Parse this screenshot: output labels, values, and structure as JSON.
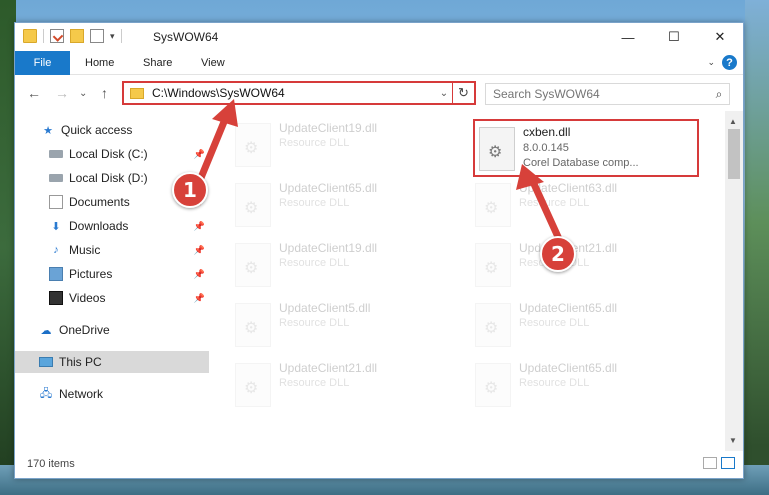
{
  "window": {
    "title": "SysWOW64",
    "controls": {
      "minimize": "—",
      "maximize": "☐",
      "close": "✕"
    }
  },
  "qat": {
    "dropdown": "▾"
  },
  "ribbon": {
    "file_label": "File",
    "tabs": [
      "Home",
      "Share",
      "View"
    ],
    "help": "?",
    "expand": "⌄"
  },
  "nav": {
    "back": "←",
    "forward": "→",
    "recent": "⌄",
    "up": "↑",
    "address": "C:\\Windows\\SysWOW64",
    "address_dropdown": "⌄",
    "refresh": "↻",
    "search_placeholder": "Search SysWOW64",
    "search_icon": "⌕"
  },
  "sidebar": {
    "pin": "📌",
    "items": [
      {
        "label": "Quick access",
        "icon": "star-icon",
        "glyph": "★"
      },
      {
        "label": "Local Disk (C:)",
        "icon": "disk-icon",
        "glyph": ""
      },
      {
        "label": "Local Disk (D:)",
        "icon": "disk-icon",
        "glyph": ""
      },
      {
        "label": "Documents",
        "icon": "document-icon",
        "glyph": ""
      },
      {
        "label": "Downloads",
        "icon": "download-icon",
        "glyph": "⬇"
      },
      {
        "label": "Music",
        "icon": "music-icon",
        "glyph": "♪"
      },
      {
        "label": "Pictures",
        "icon": "pictures-icon",
        "glyph": ""
      },
      {
        "label": "Videos",
        "icon": "videos-icon",
        "glyph": ""
      },
      {
        "label": "OneDrive",
        "icon": "cloud-icon",
        "glyph": "☁"
      },
      {
        "label": "This PC",
        "icon": "pc-icon",
        "glyph": ""
      },
      {
        "label": "Network",
        "icon": "network-icon",
        "glyph": "🖧"
      }
    ]
  },
  "files": {
    "col1": [
      {
        "name": "UpdateClient19.dll",
        "sub": "Resource DLL"
      },
      {
        "name": "UpdateClient65.dll",
        "sub": "Resource DLL"
      },
      {
        "name": "UpdateClient19.dll",
        "sub": "Resource DLL"
      },
      {
        "name": "UpdateClient5.dll",
        "sub": "Resource DLL"
      },
      {
        "name": "UpdateClient21.dll",
        "sub": "Resource DLL"
      }
    ],
    "col2": [
      {
        "name": "UpdateClient63.dll",
        "sub": "Resource DLL"
      },
      {
        "name": "UpdateClient21.dll",
        "sub": "Resource DLL"
      },
      {
        "name": "UpdateClient65.dll",
        "sub": "Resource DLL"
      },
      {
        "name": "UpdateClient65.dll",
        "sub": "Resource DLL"
      }
    ],
    "highlight": {
      "name": "cxben.dll",
      "version": "8.0.0.145",
      "company": "Corel Database comp..."
    }
  },
  "scroll": {
    "up": "▲",
    "down": "▼"
  },
  "status": {
    "item_count": "170 items"
  },
  "callouts": {
    "one": "1",
    "two": "2"
  },
  "colors": {
    "accent": "#1979ca",
    "highlight": "#d63a3a"
  }
}
